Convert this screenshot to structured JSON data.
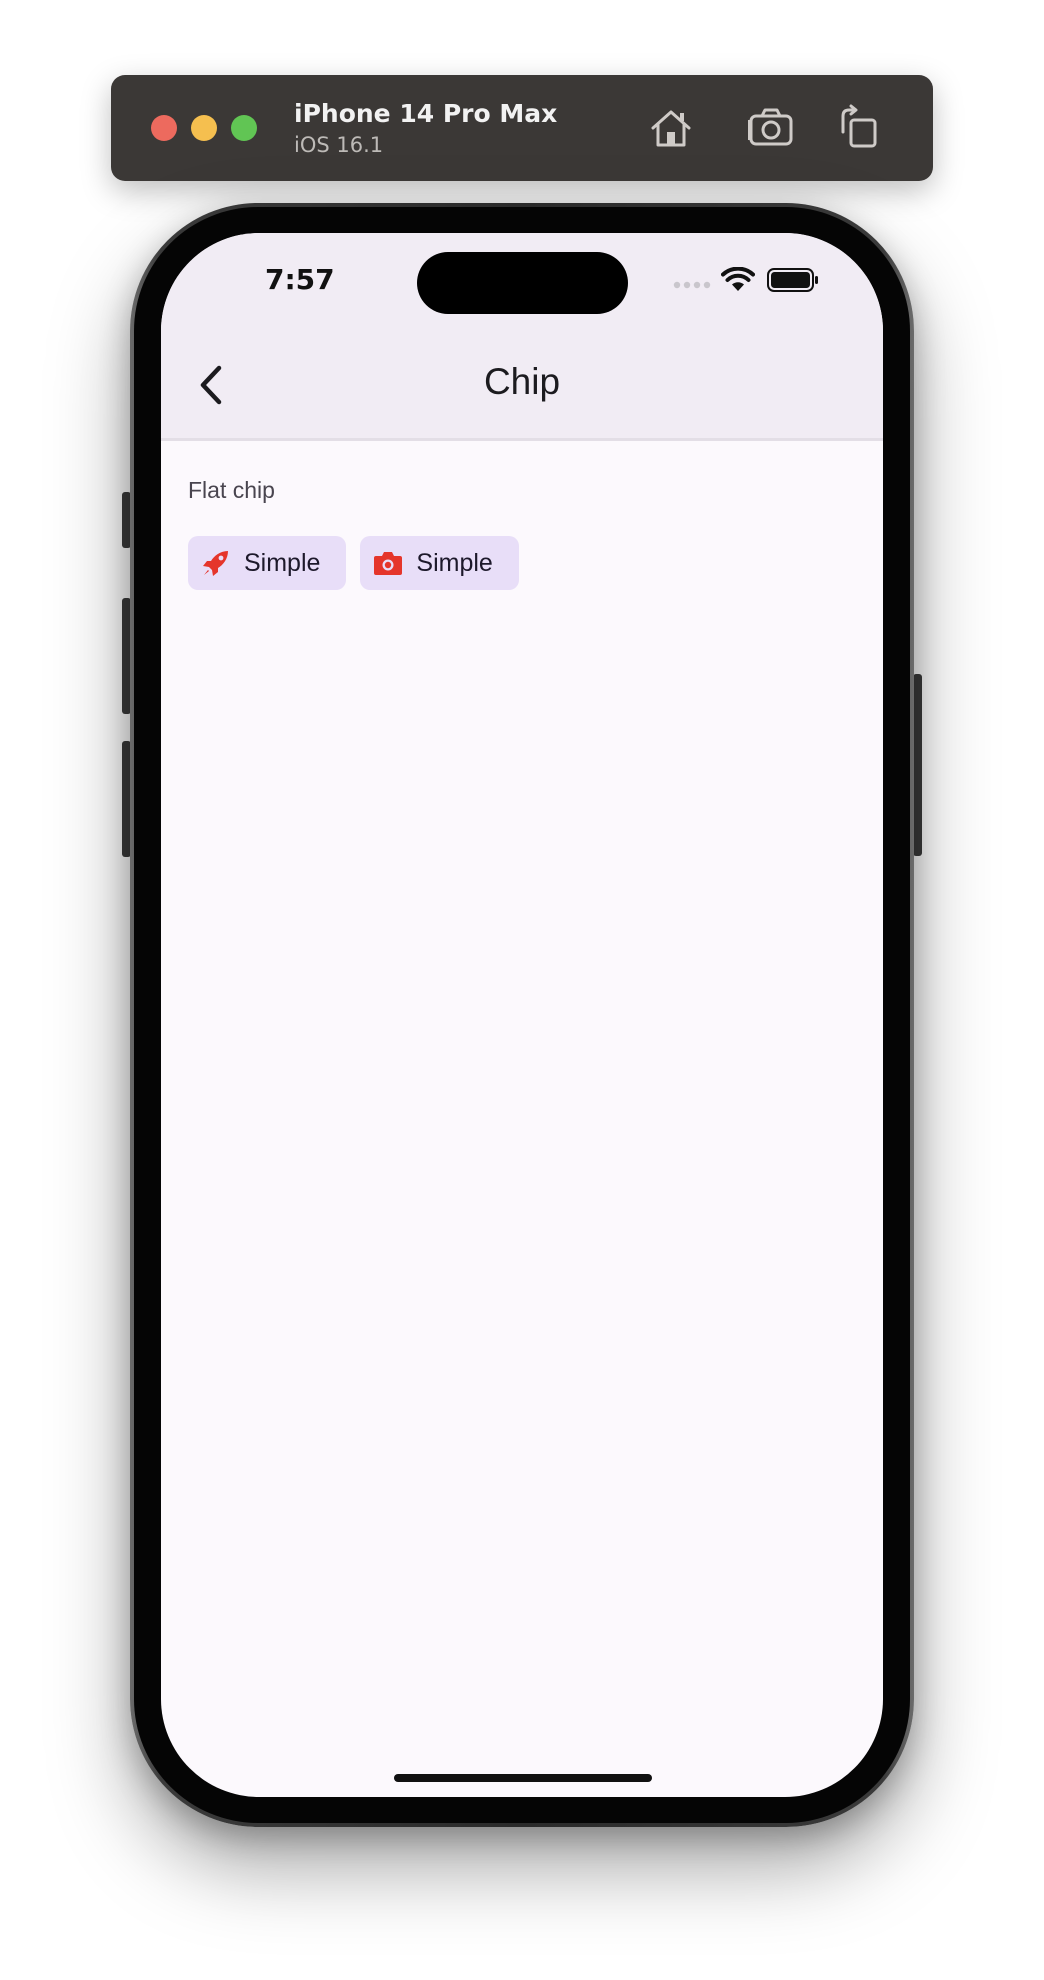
{
  "simulator": {
    "device_name": "iPhone 14 Pro Max",
    "os_version": "iOS 16.1",
    "buttons": {
      "home_icon": "home-icon",
      "screenshot_icon": "camera-icon",
      "rotate_icon": "rotate-icon"
    }
  },
  "status_bar": {
    "time": "7:57"
  },
  "app_bar": {
    "title": "Chip",
    "back_icon": "chevron-left-icon"
  },
  "content": {
    "section_label": "Flat chip",
    "chips": [
      {
        "label": "Simple",
        "icon": "rocket-icon",
        "icon_color": "#e5352b"
      },
      {
        "label": "Simple",
        "icon": "camera-icon",
        "icon_color": "#e5352b"
      }
    ]
  },
  "colors": {
    "app_bar_bg": "#f1ecf4",
    "screen_bg": "#fcf9fd",
    "chip_bg": "#e8def8",
    "chip_icon": "#e5352b"
  }
}
